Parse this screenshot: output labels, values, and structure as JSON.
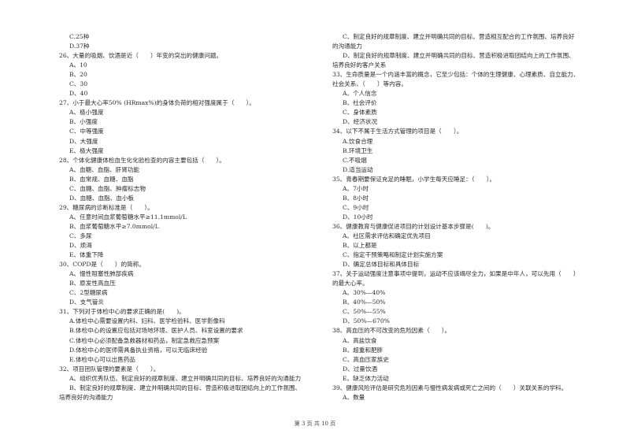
{
  "left_column": [
    {
      "type": "opt",
      "text": "C.25种"
    },
    {
      "type": "opt",
      "text": "D.37种"
    },
    {
      "type": "q",
      "text": "26、大量的吸烟、饮酒是近（　　）年变的突出的健康问题。"
    },
    {
      "type": "opt",
      "text": "A、10"
    },
    {
      "type": "opt",
      "text": "B、20"
    },
    {
      "type": "opt",
      "text": "C、30"
    },
    {
      "type": "opt",
      "text": "D、40"
    },
    {
      "type": "q",
      "text": "27、小于最大心率50% (HRmax%)的身体负荷的相对强度属于（　　）。"
    },
    {
      "type": "opt",
      "text": "A、极小强度"
    },
    {
      "type": "opt",
      "text": "B、小强度"
    },
    {
      "type": "opt",
      "text": "C、中等强度"
    },
    {
      "type": "opt",
      "text": "D、大强度"
    },
    {
      "type": "opt",
      "text": "E、极大强度"
    },
    {
      "type": "q",
      "text": "28、个体化健康体检血生化化验检查的内容主要包括（　　）。"
    },
    {
      "type": "opt",
      "text": "A、血糖、血脂、肝肾功能"
    },
    {
      "type": "opt",
      "text": "B、血常规、血糖、血脂"
    },
    {
      "type": "opt",
      "text": "C、血糖、血脂、肿瘤标志物"
    },
    {
      "type": "opt",
      "text": "D、血糖、血脂、血小板"
    },
    {
      "type": "q",
      "text": "29、糖尿病的诊断标准是（　　）。"
    },
    {
      "type": "opt",
      "text": "A、任意时间血浆葡萄糖水平≥11.1mmol/L"
    },
    {
      "type": "opt",
      "text": "B、血浆葡萄糖水平≥7.0mmol/L"
    },
    {
      "type": "opt",
      "text": "C、多尿"
    },
    {
      "type": "opt",
      "text": "D、烦渴"
    },
    {
      "type": "opt",
      "text": "E、体重下降"
    },
    {
      "type": "q",
      "text": "30、COPD是（　　）的简称。"
    },
    {
      "type": "opt",
      "text": "A、慢性阻塞性肺部疾病"
    },
    {
      "type": "opt",
      "text": "B、原发性高血压"
    },
    {
      "type": "opt",
      "text": "C、2型糖尿病"
    },
    {
      "type": "opt",
      "text": "D、支气管炎"
    },
    {
      "type": "q",
      "text": "31、下列对于体检中心的要求正确的是(　　)。"
    },
    {
      "type": "opt",
      "text": "A.体检中心需要设置内科、妇科、医学检验科、医学影像科"
    },
    {
      "type": "opt",
      "text": "B.体检中心的设置应包括对场地环境、医护人员、科室设置的要求"
    },
    {
      "type": "opt",
      "text": "C.体检中心必须配备急救器材和药品，制定急救应急预案"
    },
    {
      "type": "opt",
      "text": "D.体检中心的医师需具备执业资格，可以无临床经验"
    },
    {
      "type": "opt",
      "text": "E.体检中心可以出售药品"
    },
    {
      "type": "q",
      "text": "32、项目团队管理的要素是（　　）。"
    },
    {
      "type": "opt",
      "text": "A、组织优秀队伍、制定良好的规章制度、建立并明确共同的目标、培养良好的沟通能力"
    },
    {
      "type": "opt",
      "text": "B、制定良好的规章制度、建立并明确共同的目标、营造积极进取团结向上的工作氛围、"
    },
    {
      "type": "cont",
      "text": "培养良好的沟通能力"
    }
  ],
  "right_column": [
    {
      "type": "opt",
      "text": "C、制定良好的规章制度、建立并明确共同的目标、营造相互配合的工作氛围、培养良好"
    },
    {
      "type": "cont",
      "text": "的沟通能力"
    },
    {
      "type": "opt",
      "text": "D、制定良好的规章制度、建立并明确共同的目标、营造积极进取团结向上的工作氛围、"
    },
    {
      "type": "cont",
      "text": "培养良好的客户关系"
    },
    {
      "type": "q",
      "text": "33、生命质量是一个内涵丰富的概念，它至少包括：个体的生理健康、心理素质、自立能力、"
    },
    {
      "type": "cont",
      "text": "社会关系、（　　）等内容。"
    },
    {
      "type": "opt",
      "text": "A、个人信念"
    },
    {
      "type": "opt",
      "text": "B、社会评价"
    },
    {
      "type": "opt",
      "text": "C、身体素质"
    },
    {
      "type": "opt",
      "text": "D、经济状况"
    },
    {
      "type": "q",
      "text": "34、以下不属于生活方式管理的项目是（　　）。"
    },
    {
      "type": "opt",
      "text": "A.饮食合理"
    },
    {
      "type": "opt",
      "text": "B.环境卫生"
    },
    {
      "type": "opt",
      "text": "C.不吸烟"
    },
    {
      "type": "opt",
      "text": "D.适当运动"
    },
    {
      "type": "q",
      "text": "35、青春期要保证充足的睡眠，小学生每天应睡足：（　　）。"
    },
    {
      "type": "opt",
      "text": "A、7小时"
    },
    {
      "type": "opt",
      "text": "B、8小时"
    },
    {
      "type": "opt",
      "text": "C、9小时"
    },
    {
      "type": "opt",
      "text": "D、10小时"
    },
    {
      "type": "q",
      "text": "36、健康教育与健康促进项目的计划设计基本步骤是(　　)。"
    },
    {
      "type": "opt",
      "text": "A、社区需求评估和确定优先项目"
    },
    {
      "type": "opt",
      "text": "B、以上都是"
    },
    {
      "type": "opt",
      "text": "C、指定干预策略和制定计划实施方案"
    },
    {
      "type": "opt",
      "text": "D、确定总体目标和具体目标"
    },
    {
      "type": "q",
      "text": "37、关于运动强度注意事项中提到，运动不应该竭尽全力，如果是中年人，可以先用（　　）"
    },
    {
      "type": "cont",
      "text": "的最大心率。"
    },
    {
      "type": "opt",
      "text": "A、30%—40%"
    },
    {
      "type": "opt",
      "text": "B、40%—50%"
    },
    {
      "type": "opt",
      "text": "C、50%—55%"
    },
    {
      "type": "opt",
      "text": "D、50%—670%"
    },
    {
      "type": "q",
      "text": "38、高血压的不可改变的危险因素（　　）。"
    },
    {
      "type": "opt",
      "text": "A、高盐饮食"
    },
    {
      "type": "opt",
      "text": "B、超重和肥胖"
    },
    {
      "type": "opt",
      "text": "C、高血压家族史"
    },
    {
      "type": "opt",
      "text": "D、过量饮酒"
    },
    {
      "type": "opt",
      "text": "E、缺乏体力活动"
    },
    {
      "type": "q",
      "text": "39、健康风险评估是研究危险因素与慢性病发病或死亡之间的（　　）关联关系的学科。"
    },
    {
      "type": "opt",
      "text": "A、数量"
    }
  ],
  "footer": {
    "page_label": "第 3 页 共 10 页"
  }
}
